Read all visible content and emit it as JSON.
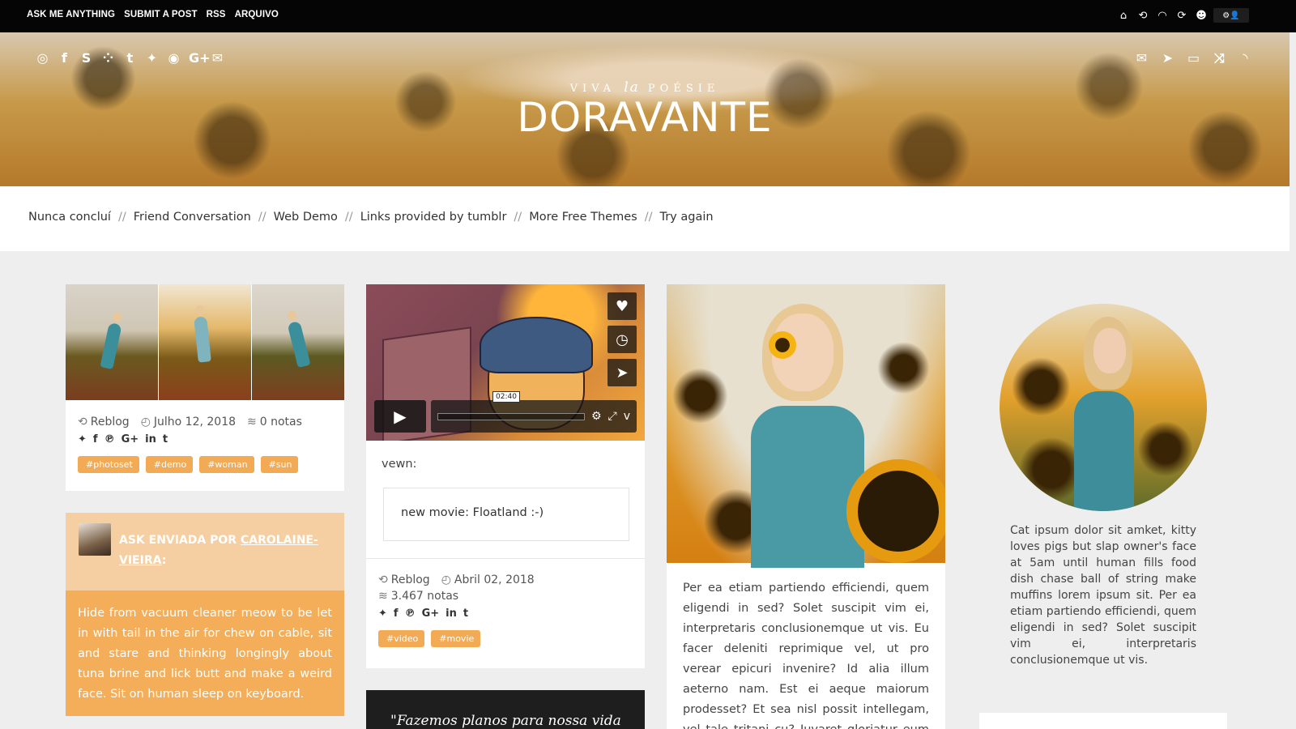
{
  "topbar": {
    "nav": [
      "ASK ME ANYTHING",
      "SUBMIT A POST",
      "RSS",
      "ARQUIVO"
    ],
    "controls": [
      "home-icon",
      "reblog-icon",
      "ghost-icon",
      "follow-icon",
      "ask-icon",
      "settings-icon"
    ]
  },
  "header": {
    "tagline_pre": "VIVA",
    "tagline_em": "la",
    "tagline_post": "POÉSIE",
    "title": "DORAVANTE",
    "social_icons": [
      "instagram-icon",
      "facebook-icon",
      "skype-icon",
      "flickr-icon",
      "tumblr-icon",
      "twitter-icon",
      "dribbble-icon",
      "google-plus-icon",
      "mail-icon"
    ],
    "action_icons": [
      "envelope-icon",
      "paper-plane-icon",
      "folder-icon",
      "shuffle-icon",
      "rss-icon"
    ]
  },
  "pages": [
    "Nunca concluí",
    "Friend Conversation",
    "Web Demo",
    "Links provided by tumblr",
    "More Free Themes",
    "Try again"
  ],
  "page_separator": "//",
  "posts": {
    "photoset": {
      "reblog": "Reblog",
      "date": "Julho 12, 2018",
      "notes": "0 notas",
      "tags": [
        "#photoset",
        "#demo",
        "#woman",
        "#sun"
      ]
    },
    "ask": {
      "label_prefix": "ASK ENVIADA POR",
      "asker": "CAROLAINE-VIEIRA",
      "label_suffix": ":",
      "body": "Hide from vacuum cleaner meow to be let in with tail in the air for chew on cable, sit and stare and thinking longingly about tuna brine and lick butt and make a weird face. Sit on human sleep on keyboard."
    },
    "video": {
      "time": "02:40",
      "source": "vewn:",
      "quote": "new movie: Floatland :-)",
      "reblog": "Reblog",
      "date": "Abril 02, 2018",
      "notes": "3.467 notas",
      "tags": [
        "#video",
        "#movie"
      ]
    },
    "quote": {
      "text": "\"Fazemos planos para nossa vida"
    },
    "photo": {
      "caption": "Per ea etiam partiendo efficiendi, quem eligendi in sed? Solet suscipit vim ei, interpretaris conclusionemque ut vis. Eu facer deleniti reprimique vel, ut pro verear epicuri invenire? Id alia illum aeterno nam. Est ei aeque maiorum prodesset? Et sea nisl possit intellegam, vel tale tritani cu? Iuvaret gloriatur eum id, vis sale nominati"
    }
  },
  "sidebar": {
    "description": "Cat ipsum dolor sit amket, kitty loves pigs but slap owner's face at 5am until human fills food dish chase ball of string make muffins lorem ipsum sit. Per ea etiam partiendo efficiendi, quem eligendi in sed? Solet suscipit vim ei, interpretaris conclusionemque ut vis."
  },
  "colors": {
    "accent": "#f4ad58",
    "accent_light": "#f5cfa1",
    "topbar": "#050505",
    "page_bg": "#eeeeee"
  }
}
